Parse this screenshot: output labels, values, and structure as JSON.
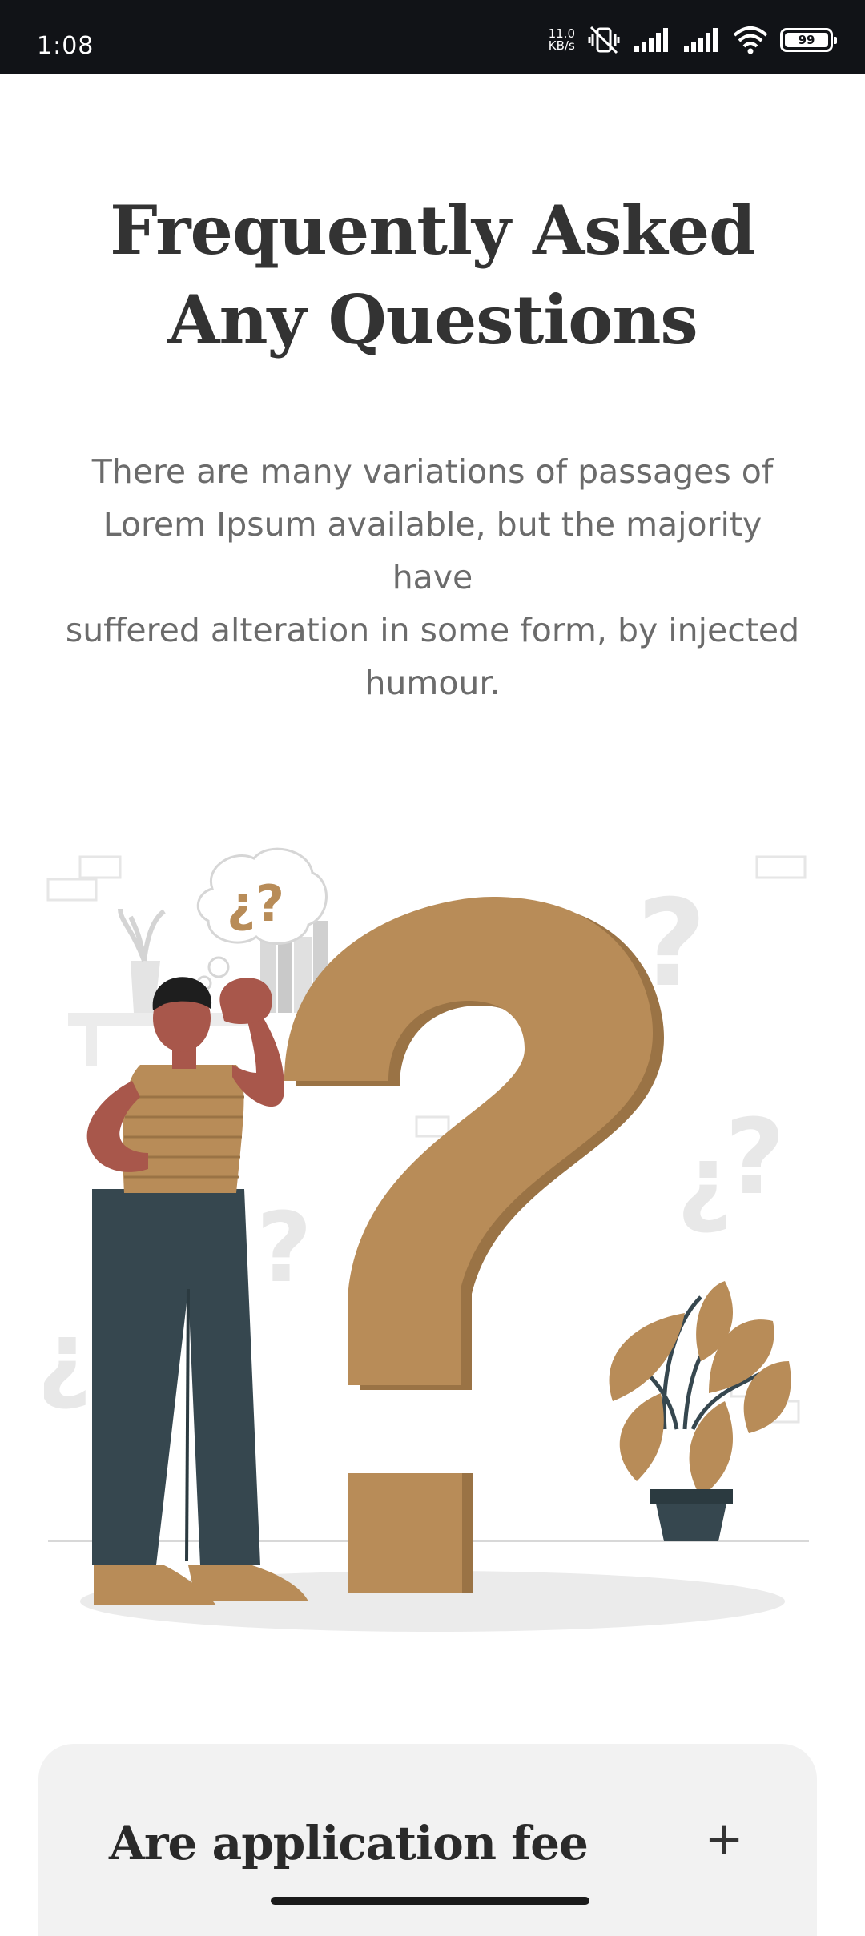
{
  "status_bar": {
    "time": "1:08",
    "net_speed_value": "11.0",
    "net_speed_unit": "KB/s",
    "battery": "99"
  },
  "header": {
    "title": "Frequently Asked Any Questions"
  },
  "intro": {
    "line1": "There are many variations of passages of",
    "line2": "Lorem Ipsum available, but the majority",
    "line3": "have",
    "line4": "suffered alteration in some form, by injected",
    "line5": "humour."
  },
  "illustration": {
    "bubble_text": "¿?",
    "accent_color": "#B88C58",
    "dark_color": "#36474F",
    "skin_color": "#A8574B"
  },
  "faq": {
    "items": [
      {
        "question": "Are application fee",
        "toggle": "+"
      }
    ]
  }
}
